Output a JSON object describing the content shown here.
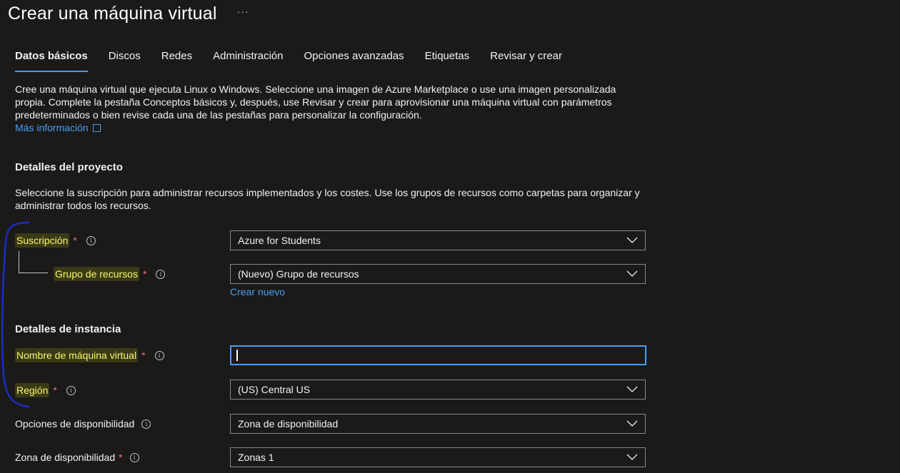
{
  "header": {
    "title": "Crear una máquina virtual",
    "more_label": "···"
  },
  "tabs": [
    {
      "label": "Datos básicos",
      "active": true
    },
    {
      "label": "Discos",
      "active": false
    },
    {
      "label": "Redes",
      "active": false
    },
    {
      "label": "Administración",
      "active": false
    },
    {
      "label": "Opciones avanzadas",
      "active": false
    },
    {
      "label": "Etiquetas",
      "active": false
    },
    {
      "label": "Revisar y crear",
      "active": false
    }
  ],
  "intro": {
    "text": "Cree una máquina virtual que ejecuta Linux o Windows. Seleccione una imagen de Azure Marketplace o use una imagen personalizada propia. Complete la pestaña Conceptos básicos y, después, use Revisar y crear para aprovisionar una máquina virtual con parámetros predeterminados o bien revise cada una de las pestañas para personalizar la configuración.",
    "learn_more": "Más información"
  },
  "project": {
    "heading": "Detalles del proyecto",
    "description": "Seleccione la suscripción para administrar recursos implementados y los costes. Use los grupos de recursos como carpetas para organizar y administrar todos los recursos.",
    "subscription": {
      "label": "Suscripción",
      "required": "*",
      "value": "Azure for Students"
    },
    "resource_group": {
      "label": "Grupo de recursos",
      "required": "*",
      "value": "(Nuevo) Grupo de recursos",
      "create_new": "Crear nuevo"
    }
  },
  "instance": {
    "heading": "Detalles de instancia",
    "vm_name": {
      "label": "Nombre de máquina virtual",
      "required": "*",
      "value": "",
      "placeholder": ""
    },
    "region": {
      "label": "Región",
      "required": "*",
      "value": "(US) Central US"
    },
    "availability_options": {
      "label": "Opciones de disponibilidad",
      "value": "Zona de disponibilidad"
    },
    "availability_zone": {
      "label": "Zona de disponibilidad",
      "required": "*",
      "value": "Zonas 1"
    }
  },
  "info_glyph": "i",
  "colors": {
    "background": "#1b1a19",
    "accent": "#479ef5",
    "required": "#f1707b",
    "highlight_text": "#f7f76a",
    "annotation": "#1a2fd6"
  }
}
